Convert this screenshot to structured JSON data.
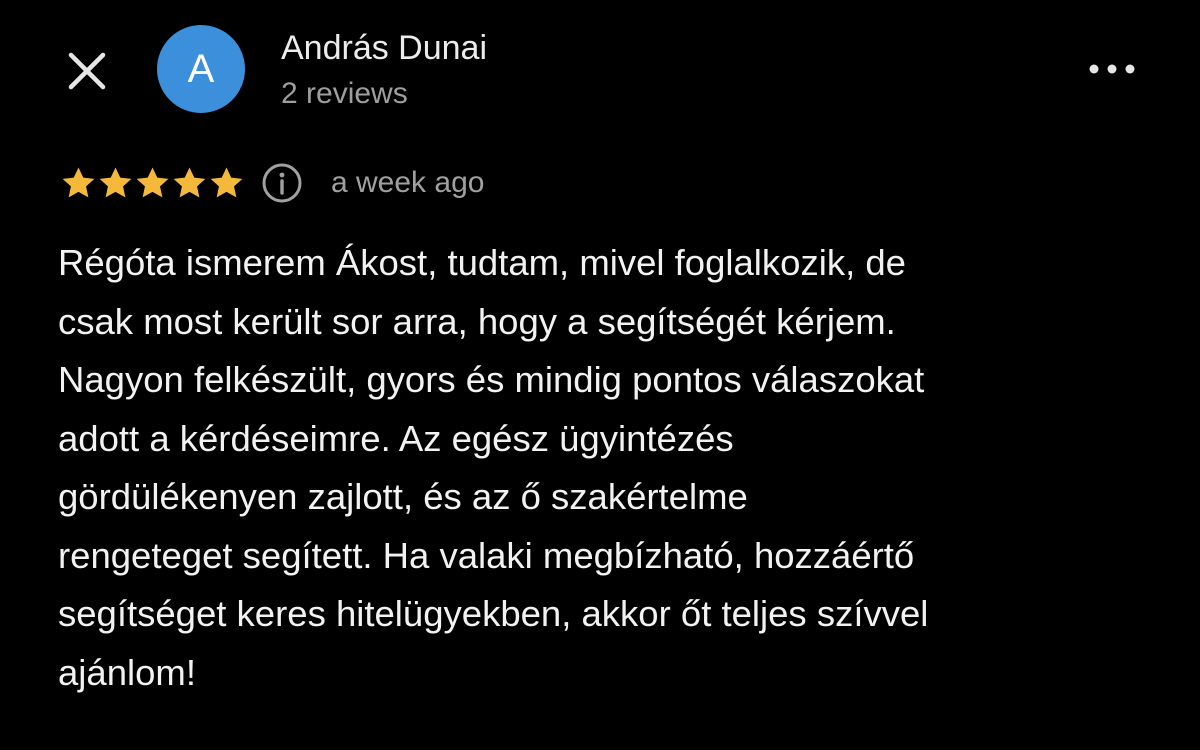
{
  "header": {
    "close_icon": "close-icon",
    "avatar_letter": "A",
    "avatar_color": "#3b8fdb",
    "reviewer_name": "András Dunai",
    "review_count": "2 reviews",
    "more_icon": "more-horizontal-icon"
  },
  "review": {
    "rating": 5,
    "rating_max": 5,
    "star_color": "#f4b83a",
    "info_icon": "info-icon",
    "date": "a week ago",
    "text": "Régóta ismerem Ákost, tudtam, mivel foglalkozik, de\ncsak most került sor arra, hogy a segítségét kérjem.\nNagyon felkészült, gyors és mindig pontos válaszokat\nadott a kérdéseimre. Az egész ügyintézés\ngördülékenyen zajlott, és az ő szakértelme\nrengeteget segített. Ha valaki megbízható, hozzáértő\nsegítséget keres hitelügyekben, akkor őt teljes szívvel\najánlom!"
  }
}
